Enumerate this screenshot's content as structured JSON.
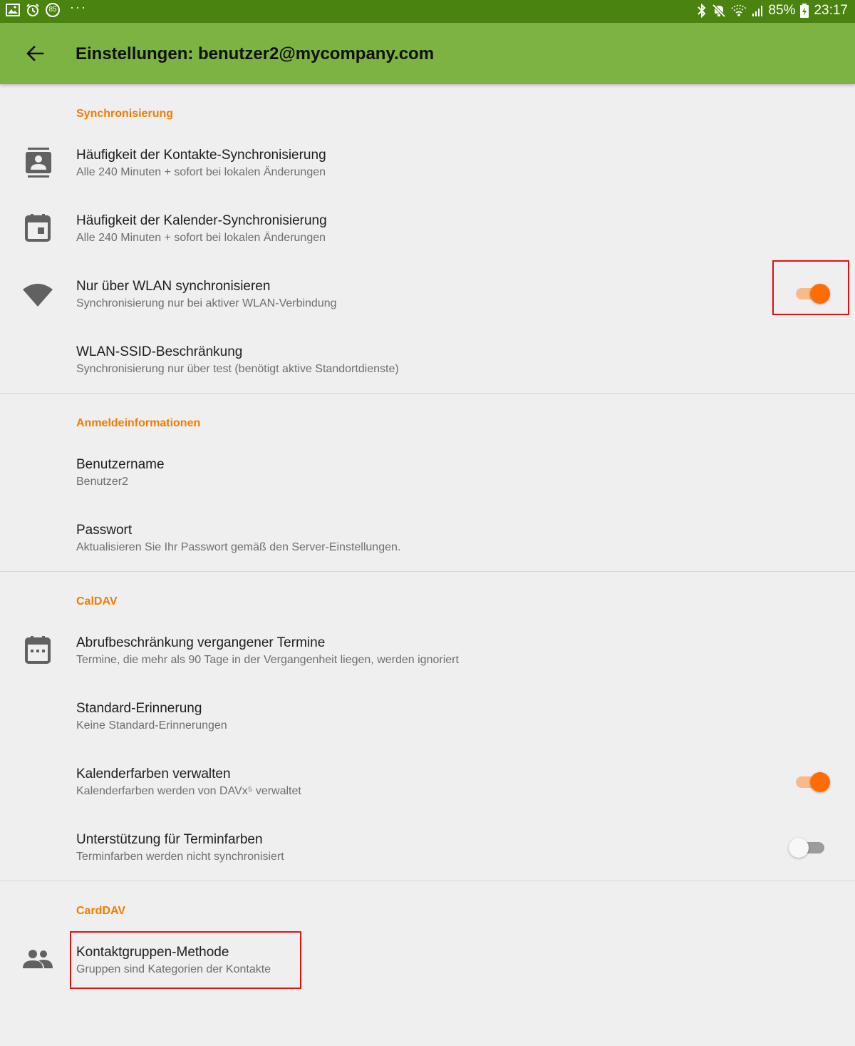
{
  "status_bar": {
    "notification_badge": "85",
    "overflow": "···",
    "battery_percent": "85%",
    "time": "23:17"
  },
  "app_bar": {
    "title": "Einstellungen: benutzer2@mycompany.com"
  },
  "sections": [
    {
      "header": "Synchronisierung",
      "items": [
        {
          "title": "Häufigkeit der Kontakte-Synchronisierung",
          "summary": "Alle 240 Minuten + sofort bei lokalen Änderungen",
          "icon": "contacts-icon"
        },
        {
          "title": "Häufigkeit der Kalender-Synchronisierung",
          "summary": "Alle 240 Minuten + sofort bei lokalen Änderungen",
          "icon": "calendar-event-icon"
        },
        {
          "title": "Nur über WLAN synchronisieren",
          "summary": "Synchronisierung nur bei aktiver WLAN-Verbindung",
          "icon": "wifi-icon",
          "switch_on": true
        },
        {
          "title": "WLAN-SSID-Beschränkung",
          "summary": "Synchronisierung nur über test (benötigt aktive Standortdienste)"
        }
      ]
    },
    {
      "header": "Anmeldeinformationen",
      "items": [
        {
          "title": "Benutzername",
          "summary": "Benutzer2"
        },
        {
          "title": "Passwort",
          "summary": "Aktualisieren Sie Ihr Passwort gemäß den Server-Einstellungen."
        }
      ]
    },
    {
      "header": "CalDAV",
      "items": [
        {
          "title": "Abrufbeschränkung vergangener Termine",
          "summary": "Termine, die mehr als 90 Tage in der Vergangenheit liegen, werden ignoriert",
          "icon": "calendar-icon"
        },
        {
          "title": "Standard-Erinnerung",
          "summary": "Keine Standard-Erinnerungen"
        },
        {
          "title": "Kalenderfarben verwalten",
          "summary": "Kalenderfarben werden von DAVx⁵ verwaltet",
          "switch_on": true
        },
        {
          "title": "Unterstützung für Terminfarben",
          "summary": "Terminfarben werden nicht synchronisiert",
          "switch_on": false
        }
      ]
    },
    {
      "header": "CardDAV",
      "items": [
        {
          "title": "Kontaktgruppen-Methode",
          "summary": "Gruppen sind Kategorien der Kontakte",
          "icon": "group-icon"
        }
      ]
    }
  ],
  "colors": {
    "status_bar": "#4b8310",
    "app_bar": "#7db342",
    "accent": "#ff6d00",
    "section_header": "#f57c00",
    "highlight": "#e41010"
  }
}
